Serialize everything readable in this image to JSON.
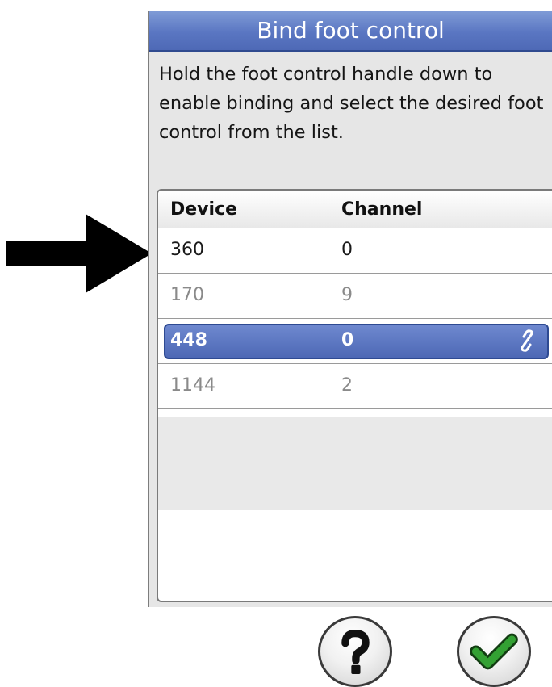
{
  "dialog": {
    "title": "Bind foot control",
    "instructions": "Hold the foot control handle down to enable binding and select the desired foot control from the list."
  },
  "table": {
    "columns": [
      "Device",
      "Channel"
    ],
    "rows": [
      {
        "device": "360",
        "channel": "0",
        "state": "normal"
      },
      {
        "device": "170",
        "channel": "9",
        "state": "dim"
      },
      {
        "device": "448",
        "channel": "0",
        "state": "selected",
        "icon": "link-icon"
      },
      {
        "device": "1144",
        "channel": "2",
        "state": "dim"
      }
    ]
  },
  "buttons": {
    "help_icon": "question-mark-icon",
    "confirm_icon": "checkmark-icon"
  },
  "colors": {
    "title_bar": "#5a76c2",
    "selected_row": "#5a73bf",
    "checkmark": "#2e8f2e"
  }
}
